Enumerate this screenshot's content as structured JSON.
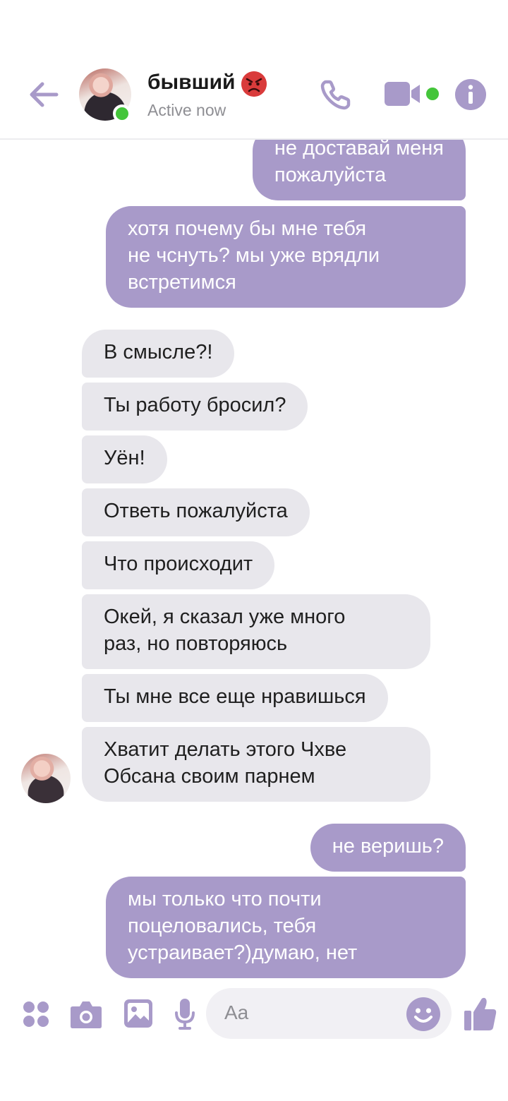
{
  "header": {
    "contact_name": "бывший",
    "status": "Active now"
  },
  "messages": [
    {
      "direction": "out",
      "text_lines": [
        "не доставай меня",
        "пожалуйста"
      ]
    },
    {
      "direction": "out",
      "text_lines": [
        "хотя почему бы мне тебя",
        "не чснуть? мы уже врядли",
        "встретимся"
      ]
    },
    {
      "direction": "in",
      "text_lines": [
        "В смысле?!"
      ]
    },
    {
      "direction": "in",
      "text_lines": [
        "Ты работу бросил?"
      ]
    },
    {
      "direction": "in",
      "text_lines": [
        "Уён!"
      ]
    },
    {
      "direction": "in",
      "text_lines": [
        "Ответь пожалуйста"
      ]
    },
    {
      "direction": "in",
      "text_lines": [
        "Что происходит"
      ]
    },
    {
      "direction": "in",
      "text_lines": [
        "Окей, я сказал уже много",
        "раз, но повторяюсь"
      ]
    },
    {
      "direction": "in",
      "text_lines": [
        "Ты мне все еще нравишься"
      ]
    },
    {
      "direction": "in",
      "text_lines": [
        "Хватит делать этого Чхве",
        "Обсана своим парнем"
      ]
    },
    {
      "direction": "out",
      "text_lines": [
        "не веришь?"
      ]
    },
    {
      "direction": "out",
      "text_lines": [
        "мы только что почти",
        "поцеловались, тебя",
        "устраивает?)думаю, нет"
      ]
    }
  ],
  "composer": {
    "placeholder": "Aa"
  },
  "icons": {
    "back": "back-arrow-icon",
    "call": "phone-icon",
    "video": "video-camera-icon",
    "info": "info-icon",
    "apps": "apps-grid-icon",
    "camera": "camera-icon",
    "gallery": "image-icon",
    "mic": "microphone-icon",
    "emoji": "smiley-icon",
    "like": "thumbs-up-icon",
    "name_emoji": "angry-face-icon"
  },
  "colors": {
    "accent": "#a89ac9",
    "outgoing_bubble": "#a89ac9",
    "incoming_bubble": "#e8e7ec",
    "online": "#44c53a"
  }
}
